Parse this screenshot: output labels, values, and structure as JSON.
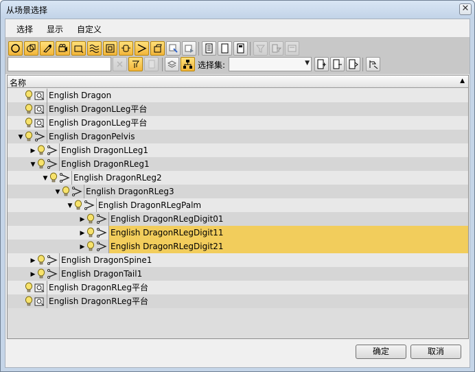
{
  "window": {
    "title": "从场景选择",
    "close_glyph": "✕"
  },
  "menu": {
    "items": [
      "选择",
      "显示",
      "自定义"
    ]
  },
  "toolbar": {
    "filter_icons": [
      {
        "icon": "geometry-icon",
        "active": true
      },
      {
        "icon": "shape-icon",
        "active": true
      },
      {
        "icon": "light-icon",
        "active": true
      },
      {
        "icon": "camera-icon",
        "active": true
      },
      {
        "icon": "helper-icon",
        "active": true
      },
      {
        "icon": "spacewarp-icon",
        "active": true
      },
      {
        "icon": "group-icon",
        "active": true
      },
      {
        "icon": "xref-icon",
        "active": true
      },
      {
        "icon": "bone-icon",
        "active": true
      },
      {
        "icon": "container-icon",
        "active": true
      },
      {
        "icon": "frozen-icon",
        "active": false
      },
      {
        "icon": "hidden-icon",
        "active": false
      }
    ],
    "select_icons": [
      "select-all-icon",
      "select-none-icon",
      "select-invert-icon"
    ],
    "extra_icons": [
      "filter-funnel-icon",
      "filter-list-icon",
      "collapse-icon"
    ],
    "row2_icons": [
      "clear-search-icon",
      "sync-selection-icon",
      "find-case-icon",
      "layers-icon",
      "hierarchy-icon"
    ],
    "selection_set_label": "选择集:",
    "selection_set_value": "",
    "search_value": "",
    "right_icons": [
      "sel-set-add-icon",
      "sel-set-remove-icon",
      "sel-set-edit-icon",
      "highlight-icon"
    ]
  },
  "tree": {
    "column_header": "名称",
    "sort_glyph": "▲",
    "rows": [
      {
        "name": "English Dragon",
        "depth": 0,
        "icon": "mesh-icon",
        "expander": "none",
        "selected": false
      },
      {
        "name": "English DragonLLeg平台",
        "depth": 0,
        "icon": "mesh-icon",
        "expander": "none",
        "selected": false
      },
      {
        "name": "English DragonLLeg平台",
        "depth": 0,
        "icon": "mesh-icon",
        "expander": "none",
        "selected": false
      },
      {
        "name": "English DragonPelvis",
        "depth": 0,
        "icon": "bone-icon",
        "expander": "open",
        "selected": false
      },
      {
        "name": "English DragonLLeg1",
        "depth": 1,
        "icon": "bone-icon",
        "expander": "closed",
        "selected": false
      },
      {
        "name": "English DragonRLeg1",
        "depth": 1,
        "icon": "bone-icon",
        "expander": "open",
        "selected": false
      },
      {
        "name": "English DragonRLeg2",
        "depth": 2,
        "icon": "bone-icon",
        "expander": "open",
        "selected": false
      },
      {
        "name": "English DragonRLeg3",
        "depth": 3,
        "icon": "bone-icon",
        "expander": "open",
        "selected": false
      },
      {
        "name": "English DragonRLegPalm",
        "depth": 4,
        "icon": "bone-icon",
        "expander": "open",
        "selected": false
      },
      {
        "name": "English DragonRLegDigit01",
        "depth": 5,
        "icon": "bone-icon",
        "expander": "closed",
        "selected": false
      },
      {
        "name": "English DragonRLegDigit11",
        "depth": 5,
        "icon": "bone-icon",
        "expander": "closed",
        "selected": true
      },
      {
        "name": "English DragonRLegDigit21",
        "depth": 5,
        "icon": "bone-icon",
        "expander": "closed",
        "selected": true
      },
      {
        "name": "English DragonSpine1",
        "depth": 1,
        "icon": "bone-icon",
        "expander": "closed",
        "selected": false
      },
      {
        "name": "English DragonTail1",
        "depth": 1,
        "icon": "bone-icon",
        "expander": "closed",
        "selected": false
      },
      {
        "name": "English DragonRLeg平台",
        "depth": 0,
        "icon": "mesh-icon",
        "expander": "none",
        "selected": false
      },
      {
        "name": "English DragonRLeg平台",
        "depth": 0,
        "icon": "mesh-icon",
        "expander": "none",
        "selected": false
      }
    ]
  },
  "footer": {
    "ok_label": "确定",
    "cancel_label": "取消"
  },
  "colors": {
    "selection": "#f2cd5c",
    "row_even": "#e8e8e8",
    "row_odd": "#d6d6d6",
    "active_button": "#f6c24a"
  }
}
